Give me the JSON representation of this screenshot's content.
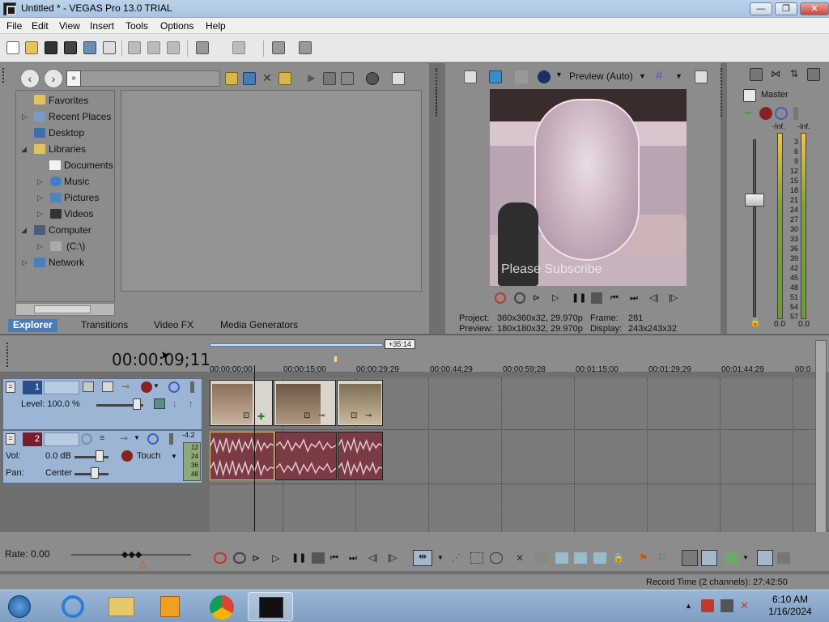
{
  "window": {
    "title": "Untitled * - VEGAS Pro 13.0 TRIAL",
    "minimize": "—",
    "restore": "❐",
    "close": "✕"
  },
  "menu": [
    "File",
    "Edit",
    "View",
    "Insert",
    "Tools",
    "Options",
    "Help"
  ],
  "explorer": {
    "tree": [
      {
        "label": "Favorites",
        "icon": "star-folder-icon"
      },
      {
        "label": "Recent Places",
        "icon": "recent-places-icon"
      },
      {
        "label": "Desktop",
        "icon": "desktop-icon"
      },
      {
        "label": "Libraries",
        "icon": "libraries-icon"
      },
      {
        "label": "Documents",
        "icon": "documents-icon"
      },
      {
        "label": "Music",
        "icon": "music-icon"
      },
      {
        "label": "Pictures",
        "icon": "pictures-icon"
      },
      {
        "label": "Videos",
        "icon": "videos-icon"
      },
      {
        "label": "Computer",
        "icon": "computer-icon"
      },
      {
        "label": "(C:\\)",
        "icon": "drive-icon"
      },
      {
        "label": "Network",
        "icon": "network-icon"
      }
    ],
    "tabs": [
      "Explorer",
      "Transitions",
      "Video FX",
      "Media Generators"
    ],
    "active_tab": "Explorer"
  },
  "preview": {
    "mode_label": "Preview (Auto)",
    "caption_overlay": "Please Subscribe",
    "project_label": "Project:",
    "project_value": "360x360x32, 29.970p",
    "preview_label": "Preview:",
    "preview_value": "180x180x32, 29.970p",
    "frame_label": "Frame:",
    "frame_value": "281",
    "display_label": "Display:",
    "display_value": "243x243x32"
  },
  "master": {
    "title": "Master",
    "left_peak": "-Inf.",
    "right_peak": "-Inf.",
    "scale": [
      "3",
      "6",
      "9",
      "12",
      "15",
      "18",
      "21",
      "24",
      "27",
      "30",
      "33",
      "36",
      "39",
      "42",
      "45",
      "48",
      "51",
      "54",
      "57"
    ],
    "left_level": "0.0",
    "right_level": "0.0"
  },
  "timeline": {
    "timecode": "00:00:09;11",
    "cursor_marker": "+35:14",
    "ruler": [
      "00:00:00;00",
      "00:00:15;00",
      "00:00:29;29",
      "00:00:44;29",
      "00:00:59;28",
      "00:01:15;00",
      "00:01:29;29",
      "00:01:44;29",
      "00:0"
    ],
    "video_track": {
      "number": "1",
      "level_label": "Level: 100.0 %"
    },
    "audio_track": {
      "number": "2",
      "vol_label": "Vol:",
      "vol_value": "0.0 dB",
      "pan_label": "Pan:",
      "pan_value": "Center",
      "automation": "Touch",
      "meter_top": "-4.2",
      "meter_scale": [
        "12",
        "24",
        "36",
        "48"
      ]
    },
    "rate": "Rate: 0.00"
  },
  "status": {
    "record_time": "Record Time (2 channels): 27:42:50"
  },
  "taskbar": {
    "time": "6:10 AM",
    "date": "1/16/2024"
  },
  "colors": {
    "panel": "#8c8c8c",
    "track_header": "#9db5d5",
    "audio_clip": "#7a3b45",
    "active_tab": "#4d7cb5"
  }
}
